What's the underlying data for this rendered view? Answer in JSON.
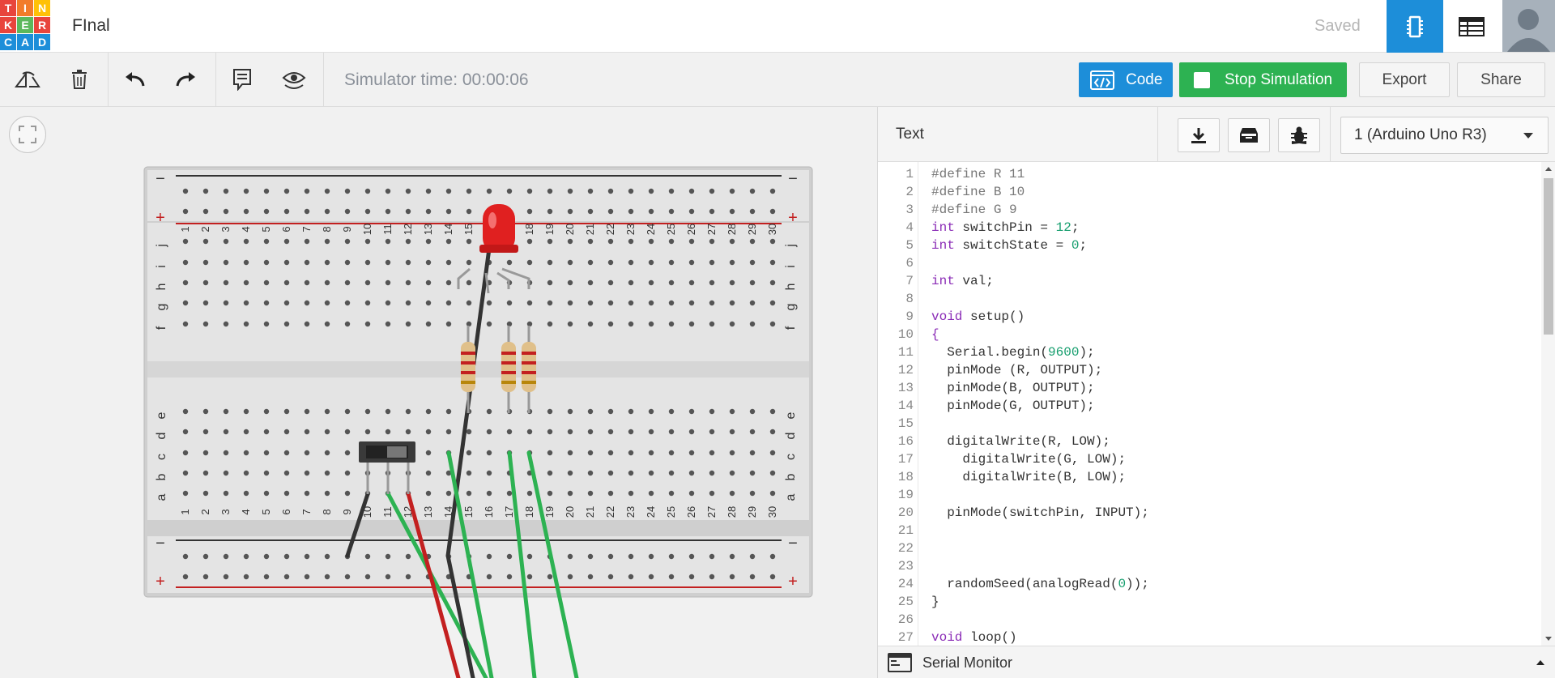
{
  "app": {
    "logo_letters": [
      "T",
      "I",
      "N",
      "K",
      "E",
      "R",
      "C",
      "A",
      "D"
    ],
    "logo_colors": [
      "#e8453c",
      "#f27c2a",
      "#ffc107",
      "#e8453c",
      "#5cb85c",
      "#e8453c",
      "#1d8ed9",
      "#1d8ed9",
      "#1d8ed9"
    ],
    "project_title": "FInal",
    "save_status": "Saved"
  },
  "toolbar": {
    "sim_time_label": "Simulator time: 00:00:06",
    "code_label": "Code",
    "stop_label": "Stop Simulation",
    "export_label": "Export",
    "share_label": "Share",
    "accent_blue": "#1d8ed9",
    "accent_green": "#2db252"
  },
  "breadboard": {
    "column_labels": [
      "1",
      "2",
      "3",
      "4",
      "5",
      "6",
      "7",
      "8",
      "9",
      "10",
      "11",
      "12",
      "13",
      "14",
      "15",
      "16",
      "17",
      "18",
      "19",
      "20",
      "21",
      "22",
      "23",
      "24",
      "25",
      "26",
      "27",
      "28",
      "29",
      "30"
    ],
    "row_labels_top": [
      "j",
      "i",
      "h",
      "g",
      "f"
    ],
    "row_labels_bottom": [
      "e",
      "d",
      "c",
      "b",
      "a"
    ],
    "minus_sign": "−",
    "plus_sign": "+"
  },
  "panel": {
    "mode_label": "Text",
    "board_select": "1 (Arduino Uno R3)",
    "serial_monitor_label": "Serial Monitor"
  },
  "code": [
    {
      "n": "1",
      "t": "#define R 11",
      "k": "dir"
    },
    {
      "n": "2",
      "t": "#define B 10",
      "k": "dir"
    },
    {
      "n": "3",
      "t": "#define G 9",
      "k": "dir"
    },
    {
      "n": "4",
      "t": "int switchPin = 12;",
      "k": "mix"
    },
    {
      "n": "5",
      "t": "int switchState = 0;",
      "k": "mix"
    },
    {
      "n": "6",
      "t": "",
      "k": "txt"
    },
    {
      "n": "7",
      "t": "int val;",
      "k": "mix"
    },
    {
      "n": "8",
      "t": "",
      "k": "txt"
    },
    {
      "n": "9",
      "t": "void setup()",
      "k": "mix"
    },
    {
      "n": "10",
      "t": "{",
      "k": "kwonly"
    },
    {
      "n": "11",
      "t": "  Serial.begin(9600);",
      "k": "mix"
    },
    {
      "n": "12",
      "t": "  pinMode (R, OUTPUT);",
      "k": "txt"
    },
    {
      "n": "13",
      "t": "  pinMode(B, OUTPUT);",
      "k": "txt"
    },
    {
      "n": "14",
      "t": "  pinMode(G, OUTPUT);",
      "k": "txt"
    },
    {
      "n": "15",
      "t": "",
      "k": "txt"
    },
    {
      "n": "16",
      "t": "  digitalWrite(R, LOW);",
      "k": "txt"
    },
    {
      "n": "17",
      "t": "    digitalWrite(G, LOW);",
      "k": "txt"
    },
    {
      "n": "18",
      "t": "    digitalWrite(B, LOW);",
      "k": "txt"
    },
    {
      "n": "19",
      "t": "",
      "k": "txt"
    },
    {
      "n": "20",
      "t": "  pinMode(switchPin, INPUT);",
      "k": "txt"
    },
    {
      "n": "21",
      "t": "",
      "k": "txt"
    },
    {
      "n": "22",
      "t": "",
      "k": "txt"
    },
    {
      "n": "23",
      "t": "",
      "k": "txt"
    },
    {
      "n": "24",
      "t": "  randomSeed(analogRead(0));",
      "k": "mix"
    },
    {
      "n": "25",
      "t": "}",
      "k": "txt"
    },
    {
      "n": "26",
      "t": "",
      "k": "txt"
    },
    {
      "n": "27",
      "t": "void loop()",
      "k": "mix"
    }
  ]
}
